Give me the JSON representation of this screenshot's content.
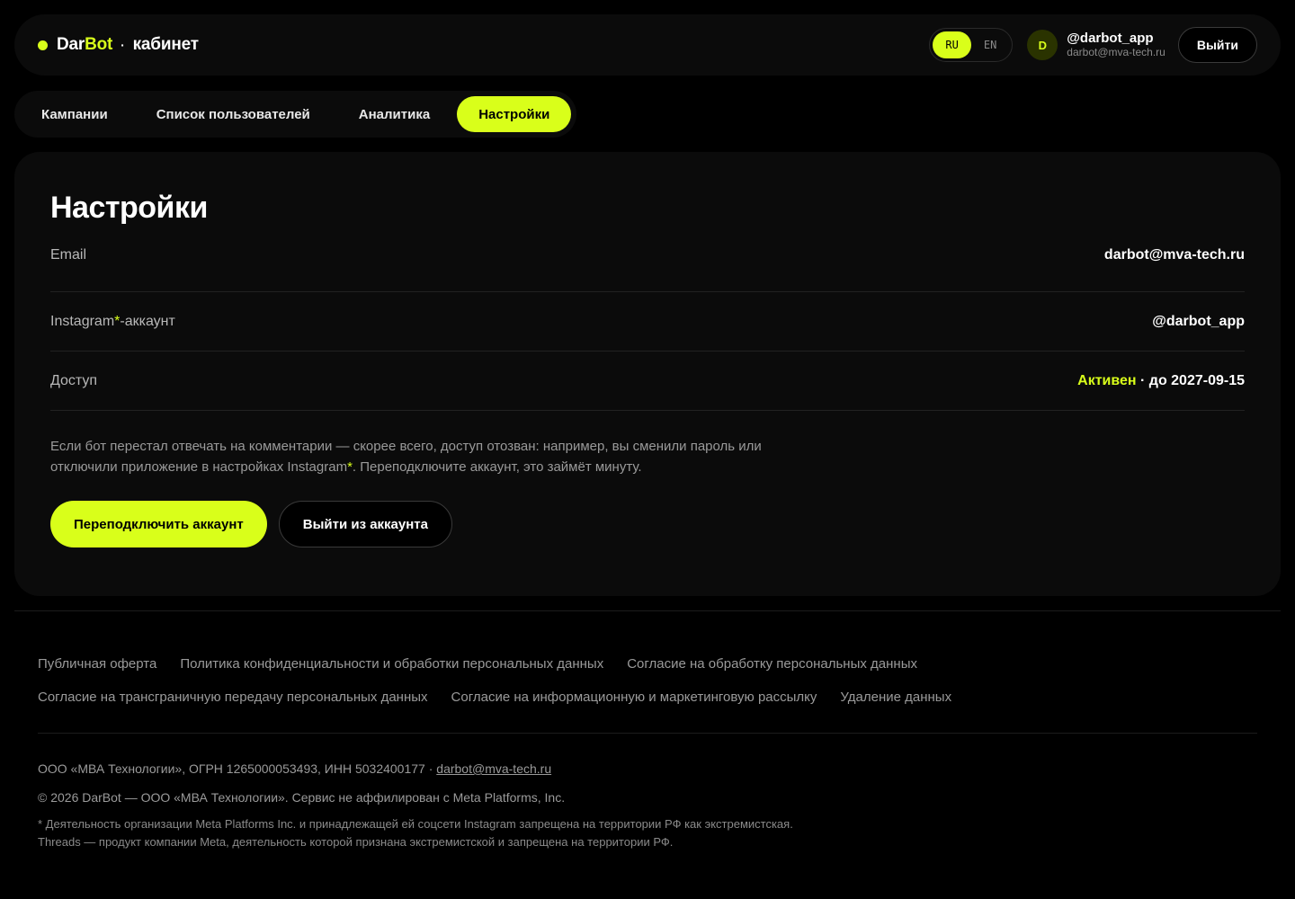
{
  "header": {
    "brand": {
      "part1": "Dar",
      "part2": "Bot",
      "separator": "·",
      "suffix": "кабинет"
    },
    "languages": [
      {
        "code": "RU",
        "active": true
      },
      {
        "code": "EN",
        "active": false
      }
    ],
    "user": {
      "avatar_letter": "D",
      "handle": "@darbot_app",
      "email": "darbot@mva-tech.ru"
    },
    "logout_label": "Выйти"
  },
  "tabs": [
    {
      "label": "Кампании",
      "active": false
    },
    {
      "label": "Список пользователей",
      "active": false
    },
    {
      "label": "Аналитика",
      "active": false
    },
    {
      "label": "Настройки",
      "active": true
    }
  ],
  "settings": {
    "title": "Настройки",
    "rows": {
      "email": {
        "label": "Email",
        "value": "darbot@mva-tech.ru"
      },
      "instagram": {
        "label_prefix": "Instagram",
        "label_mark": "*",
        "label_suffix": "-аккаунт",
        "value": "@darbot_app"
      },
      "access": {
        "label": "Доступ",
        "status": "Активен",
        "separator": " · ",
        "until": "до 2027-09-15"
      }
    },
    "hint": {
      "part1": "Если бот перестал отвечать на комментарии — скорее всего, доступ отозван: например, вы сменили пароль или отключили приложение в настройках Instagram",
      "mark": "*",
      "part2": ". Переподключите аккаунт, это займёт минуту."
    },
    "reconnect_label": "Переподключить аккаунт",
    "logout_account_label": "Выйти из аккаунта"
  },
  "footer": {
    "links_row1": [
      "Публичная оферта",
      "Политика конфиденциальности и обработки персональных данных",
      "Согласие на обработку персональных данных"
    ],
    "links_row2": [
      "Согласие на трансграничную передачу персональных данных",
      "Согласие на информационную и маркетинговую рассылку",
      "Удаление данных"
    ],
    "company_line": "ООО «МВА Технологии», ОГРН 1265000053493, ИНН 5032400177 · ",
    "company_email": "darbot@mva-tech.ru",
    "copyright": "© 2026 DarBot — ООО «МВА Технологии». Сервис не аффилирован с Meta Platforms, Inc.",
    "disclaimer": "* Деятельность организации Meta Platforms Inc. и принадлежащей ей соцсети Instagram запрещена на территории РФ как экстремистская. Threads — продукт компании Meta, деятельность которой признана экстремистской и запрещена на территории РФ."
  },
  "colors": {
    "accent": "#d9ff1a",
    "background": "#000000",
    "surface": "#0b0b0b"
  }
}
